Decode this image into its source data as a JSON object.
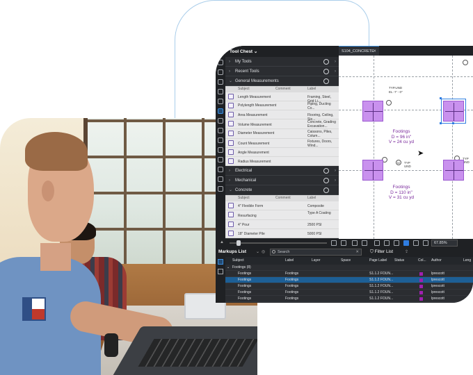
{
  "toolchest": {
    "title": "Tool Chest",
    "sections": [
      {
        "label": "My Tools"
      },
      {
        "label": "Recent Tools"
      },
      {
        "label": "General Measurements"
      }
    ],
    "columns": {
      "subject": "Subject",
      "comment": "Comment",
      "label": "Label"
    },
    "measurements": [
      {
        "subject": "Length Measurement",
        "label": "Framing, Steel, Grid Li..."
      },
      {
        "subject": "Polylength Measurement",
        "label": "Piping, Ducting Co..."
      },
      {
        "subject": "Area Measurement",
        "label": "Flooring, Ceiling, Siz..."
      },
      {
        "subject": "Volume Measurement",
        "label": "Concrete, Grading Excavation..."
      },
      {
        "subject": "Diameter Measurement",
        "label": "Caissons, Piles, Colum..."
      },
      {
        "subject": "Count Measurement",
        "label": "Fixtures, Doors, Wind..."
      },
      {
        "subject": "Angle Measurement",
        "label": ""
      },
      {
        "subject": "Radius Measurement",
        "label": ""
      }
    ],
    "groups": [
      {
        "label": "Electrical"
      },
      {
        "label": "Mechanical"
      },
      {
        "label": "Concrete"
      }
    ],
    "concrete_items": [
      {
        "subject": "4\" Flexible Form",
        "label": "Composite"
      },
      {
        "subject": "Resurfacing",
        "label": "Type A Coating"
      },
      {
        "subject": "4\" Pour",
        "label": "2500 PSI"
      },
      {
        "subject": "18\" Diameter Pile",
        "label": "5000 PSI"
      }
    ]
  },
  "document": {
    "tab_label": "S104_CONCRETE",
    "footings": [
      {
        "name": "Footings",
        "d": "D = 96 in\"",
        "v": "V = 24 cu yd"
      },
      {
        "name": "Footings",
        "d": "D = 110 in\"",
        "v": "V = 31 cu yd"
      }
    ],
    "tags": {
      "typ_und": "TYP.UND",
      "el": "EL -7' - 0\"",
      "typ": "TYP",
      "und": "UND",
      "gb": "GB-1",
      "gb_num": "92"
    }
  },
  "status": {
    "zoom": "67.85%"
  },
  "markups": {
    "title": "Markups List",
    "search_placeholder": "Search",
    "filter_label": "Filter List",
    "columns": {
      "subject": "Subject",
      "label": "Label",
      "layer": "Layer",
      "space": "Space",
      "page_label": "Page Label",
      "status": "Status",
      "color": "Col...",
      "author": "Author",
      "length": "Leng"
    },
    "group_label": "Footings (8)",
    "rows": [
      {
        "subject": "Footings",
        "label": "Footings",
        "page": "S1.1.2 FOUN...",
        "author": "lprescott"
      },
      {
        "subject": "Footings",
        "label": "Footings",
        "page": "S1.1.2 FOUN...",
        "author": "lprescott"
      },
      {
        "subject": "Footings",
        "label": "Footings",
        "page": "S1.1.2 FOUN...",
        "author": "lprescott"
      },
      {
        "subject": "Footings",
        "label": "Footings",
        "page": "S1.1.2 FOUN...",
        "author": "lprescott"
      },
      {
        "subject": "Footings",
        "label": "Footings",
        "page": "S1.1.2 FOUN...",
        "author": "lprescott"
      }
    ],
    "colors": {
      "accent": "#2f7de1",
      "selected_row": "#1d5f96",
      "markup_color": "#a020b0"
    }
  }
}
